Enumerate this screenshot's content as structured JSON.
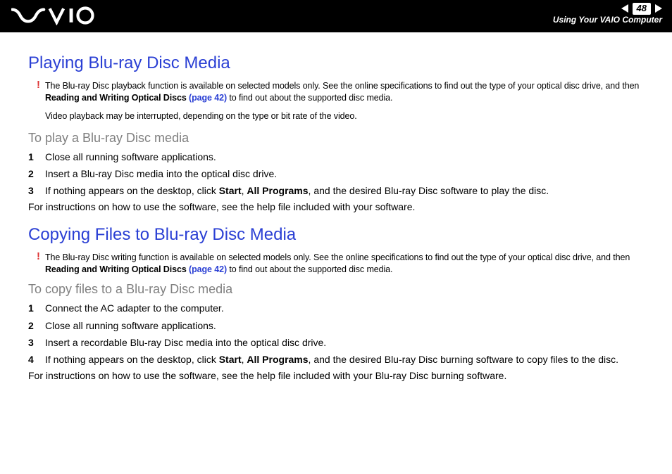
{
  "header": {
    "page_number": "48",
    "breadcrumb": "Using Your VAIO Computer"
  },
  "section1": {
    "title": "Playing Blu-ray Disc Media",
    "warning_pre": "The Blu-ray Disc playback function is available on selected models only. See the online specifications to find out the type of your optical disc drive, and then ",
    "warning_bold": "Reading and Writing Optical Discs ",
    "warning_link": "(page 42)",
    "warning_post": " to find out about the supported disc media.",
    "note": "Video playback may be interrupted, depending on the type or bit rate of the video.",
    "subtitle": "To play a Blu-ray Disc media",
    "steps": {
      "s1": "Close all running software applications.",
      "s2": "Insert a Blu-ray Disc media into the optical disc drive.",
      "s3_pre": "If nothing appears on the desktop, click ",
      "s3_b1": "Start",
      "s3_mid": ", ",
      "s3_b2": "All Programs",
      "s3_post": ", and the desired Blu-ray Disc software to play the disc."
    },
    "after": "For instructions on how to use the software, see the help file included with your software."
  },
  "section2": {
    "title": "Copying Files to Blu-ray Disc Media",
    "warning_pre": "The Blu-ray Disc writing function is available on selected models only. See the online specifications to find out the type of your optical disc drive, and then ",
    "warning_bold": "Reading and Writing Optical Discs ",
    "warning_link": "(page 42)",
    "warning_post": " to find out about the supported disc media.",
    "subtitle": "To copy files to a Blu-ray Disc media",
    "steps": {
      "s1": "Connect the AC adapter to the computer.",
      "s2": "Close all running software applications.",
      "s3": "Insert a recordable Blu-ray Disc media into the optical disc drive.",
      "s4_pre": "If nothing appears on the desktop, click ",
      "s4_b1": "Start",
      "s4_mid": ", ",
      "s4_b2": "All Programs",
      "s4_post": ", and the desired Blu-ray Disc burning software to copy files to the disc."
    },
    "after": "For instructions on how to use the software, see the help file included with your Blu-ray Disc burning software."
  }
}
